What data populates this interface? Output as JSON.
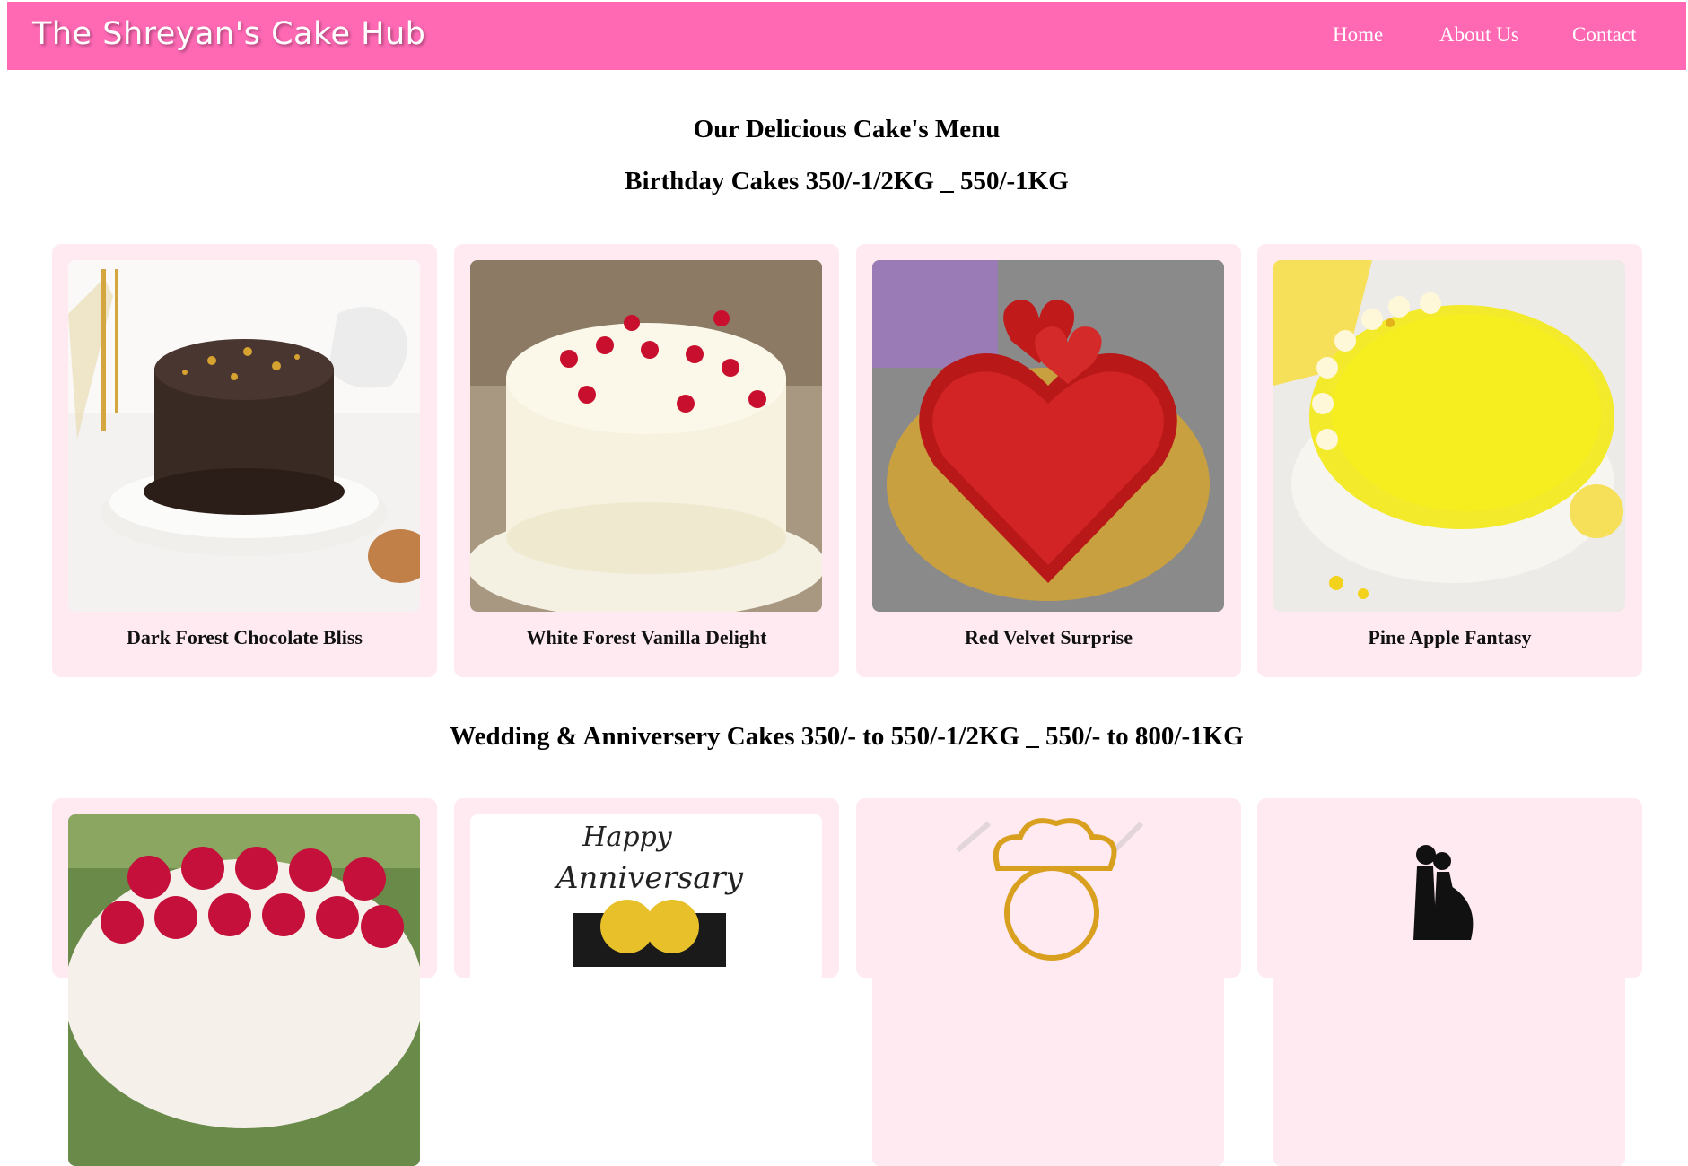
{
  "header": {
    "brand": "The Shreyan's Cake Hub",
    "nav": [
      "Home",
      "About Us",
      "Contact"
    ]
  },
  "main": {
    "title": "Our Delicious Cake's Menu",
    "birthday_heading": "Birthday Cakes 350/-1/2KG _ 550/-1KG",
    "wedding_heading": "Wedding & Anniversery Cakes 350/- to 550/-1/2KG _ 550/- to 800/-1KG",
    "birthday_cakes": [
      {
        "name": "Dark Forest Chocolate Bliss",
        "icon": "chocolate-cake-image"
      },
      {
        "name": "White Forest Vanilla Delight",
        "icon": "white-forest-cake-image"
      },
      {
        "name": "Red Velvet Surprise",
        "icon": "red-velvet-heart-cake-image"
      },
      {
        "name": "Pine Apple Fantasy",
        "icon": "pineapple-cake-image"
      }
    ],
    "wedding_cakes": [
      {
        "icon": "red-rose-cake-image"
      },
      {
        "icon": "happy-anniversary-cake-image",
        "text": "Happy Anniversary"
      },
      {
        "icon": "chef-logo-image"
      },
      {
        "icon": "couple-silhouette-image"
      }
    ]
  },
  "colors": {
    "nav_bg": "#ff69b4",
    "card_bg": "#ffeaf2"
  }
}
